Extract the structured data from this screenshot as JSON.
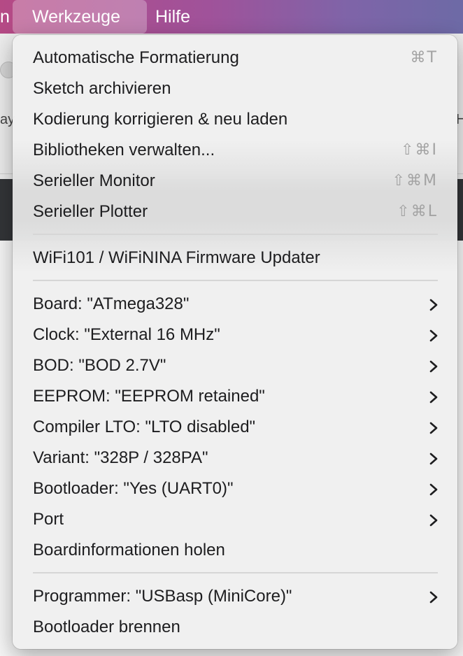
{
  "menubar": {
    "partial_left": "n",
    "tools": "Werkzeuge",
    "help": "Hilfe"
  },
  "background": {
    "left_fragment": "ay",
    "right_fragment": "H"
  },
  "menu": {
    "items": [
      {
        "label": "Automatische Formatierung",
        "shortcut": "⌘T"
      },
      {
        "label": "Sketch archivieren",
        "shortcut": ""
      },
      {
        "label": "Kodierung korrigieren & neu laden",
        "shortcut": ""
      },
      {
        "label": "Bibliotheken verwalten...",
        "shortcut": "⇧⌘I"
      },
      {
        "label": "Serieller Monitor",
        "shortcut": "⇧⌘M"
      },
      {
        "label": "Serieller Plotter",
        "shortcut": "⇧⌘L"
      },
      {
        "label": "WiFi101 / WiFiNINA Firmware Updater",
        "shortcut": ""
      },
      {
        "label": "Board: \"ATmega328\"",
        "submenu": true
      },
      {
        "label": "Clock: \"External 16 MHz\"",
        "submenu": true
      },
      {
        "label": "BOD: \"BOD 2.7V\"",
        "submenu": true
      },
      {
        "label": "EEPROM: \"EEPROM retained\"",
        "submenu": true
      },
      {
        "label": "Compiler LTO: \"LTO disabled\"",
        "submenu": true
      },
      {
        "label": "Variant: \"328P / 328PA\"",
        "submenu": true
      },
      {
        "label": "Bootloader: \"Yes (UART0)\"",
        "submenu": true
      },
      {
        "label": "Port",
        "submenu": true
      },
      {
        "label": "Boardinformationen holen",
        "submenu": false
      },
      {
        "label": "Programmer: \"USBasp (MiniCore)\"",
        "submenu": true
      },
      {
        "label": "Bootloader brennen",
        "submenu": false
      }
    ]
  },
  "colors": {
    "menubar_gradient_start": "#b54a85",
    "menubar_gradient_end": "#6d6aa6",
    "menu_background": "#f0f0f0",
    "menu_text": "#1d1d1f",
    "shortcut_text": "#a3a3a3"
  },
  "icons": {
    "submenu": "chevron-right-icon"
  }
}
